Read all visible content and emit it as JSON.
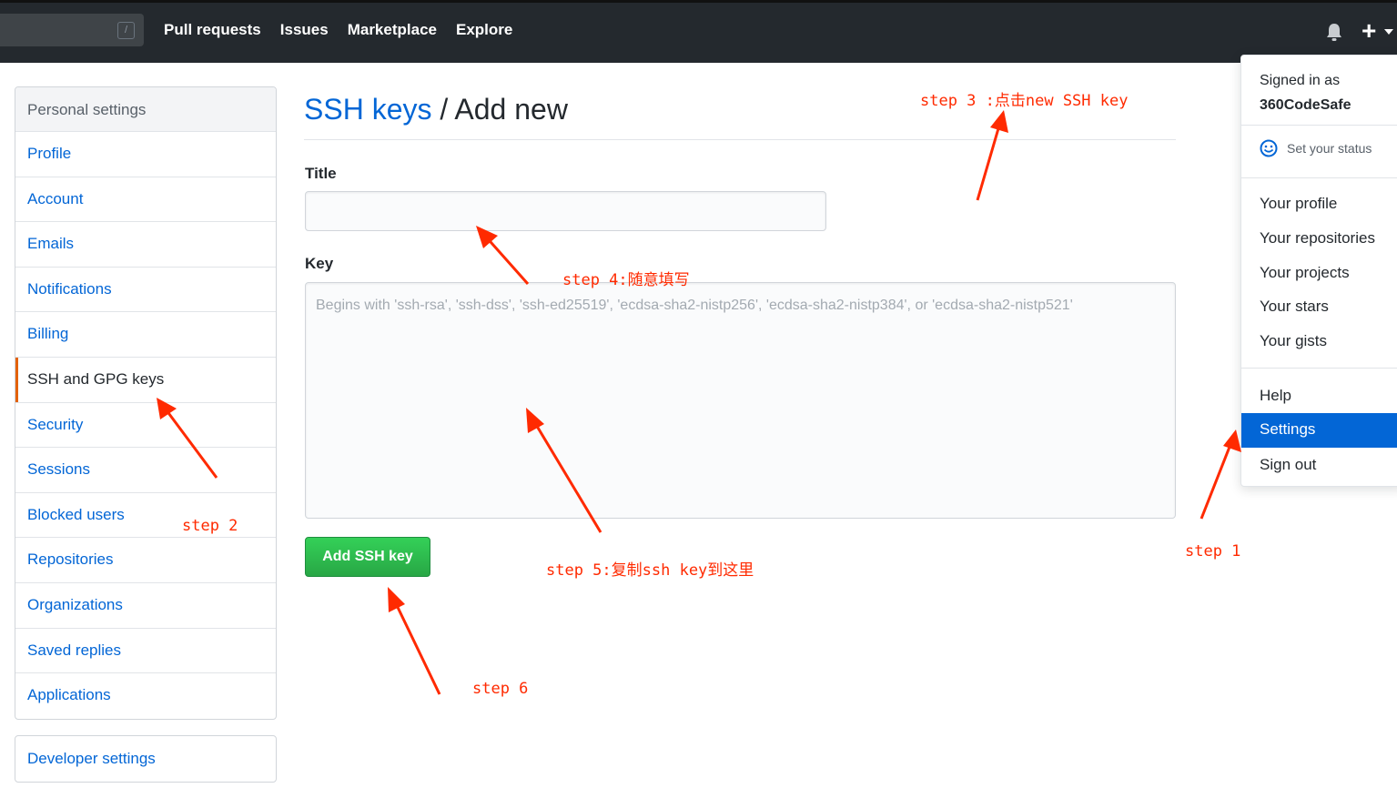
{
  "header": {
    "search_shortcut": "/",
    "nav": [
      "Pull requests",
      "Issues",
      "Marketplace",
      "Explore"
    ],
    "icons": [
      "bell-icon",
      "plus-icon",
      "caret-down-icon"
    ]
  },
  "sidebar": {
    "title": "Personal settings",
    "items": [
      {
        "label": "Profile",
        "active": false
      },
      {
        "label": "Account",
        "active": false
      },
      {
        "label": "Emails",
        "active": false
      },
      {
        "label": "Notifications",
        "active": false
      },
      {
        "label": "Billing",
        "active": false
      },
      {
        "label": "SSH and GPG keys",
        "active": true
      },
      {
        "label": "Security",
        "active": false
      },
      {
        "label": "Sessions",
        "active": false
      },
      {
        "label": "Blocked users",
        "active": false
      },
      {
        "label": "Repositories",
        "active": false
      },
      {
        "label": "Organizations",
        "active": false
      },
      {
        "label": "Saved replies",
        "active": false
      },
      {
        "label": "Applications",
        "active": false
      }
    ],
    "developer_settings": "Developer settings"
  },
  "main": {
    "breadcrumb": "SSH keys",
    "separator": "/",
    "title": "Add new",
    "title_label": "Title",
    "title_value": "",
    "key_label": "Key",
    "key_placeholder": "Begins with 'ssh-rsa', 'ssh-dss', 'ssh-ed25519', 'ecdsa-sha2-nistp256', 'ecdsa-sha2-nistp384', or 'ecdsa-sha2-nistp521'",
    "add_button": "Add SSH key"
  },
  "dropdown": {
    "signed_in_as": "Signed in as",
    "username": "360CodeSafe",
    "set_status": "Set your status",
    "items": [
      "Your profile",
      "Your repositories",
      "Your projects",
      "Your stars",
      "Your gists",
      "Help",
      "Settings",
      "Sign out"
    ],
    "active_item": "Settings"
  },
  "annotations": {
    "step1": "step 1",
    "step2": "step 2",
    "step3": "step 3 :点击new SSH key",
    "step4": "step 4:随意填写",
    "step5": "step 5:复制ssh key到这里",
    "step6": "step 6",
    "color": "#ff2a00"
  },
  "colors": {
    "header_bg": "#24292e",
    "link": "#0366d6",
    "active_marker": "#e36209",
    "button_green": "#28a745",
    "dropdown_active": "#0366d6"
  }
}
